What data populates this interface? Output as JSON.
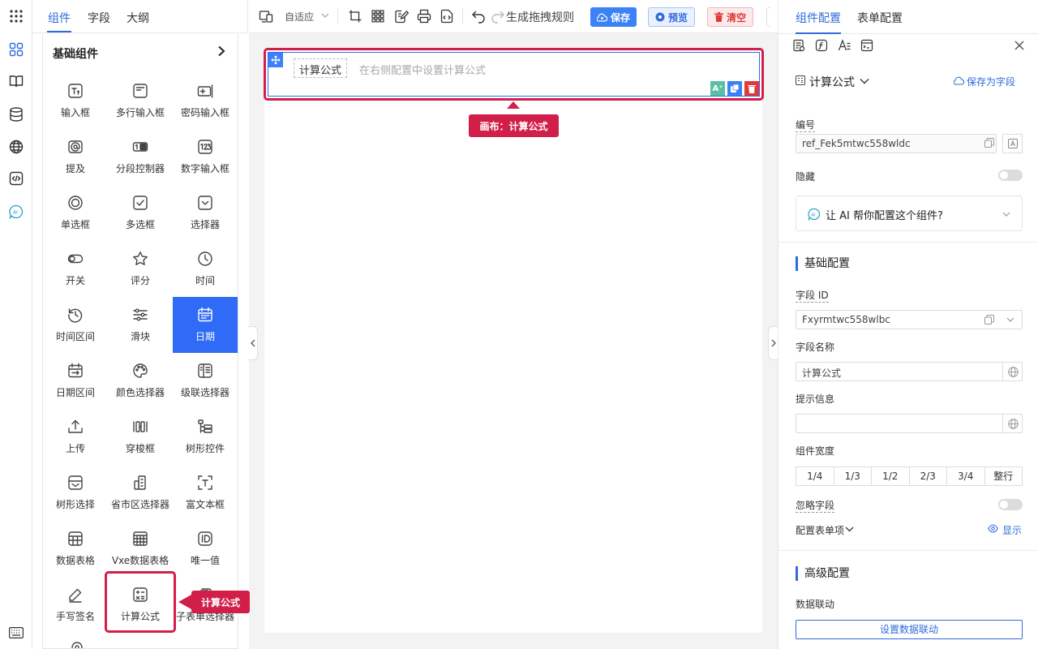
{
  "rail": {
    "items": [
      "apps-icon",
      "widgets-icon",
      "book-icon",
      "database-icon",
      "globe-icon",
      "code-icon",
      "ai-icon",
      "keyboard-icon"
    ]
  },
  "left_tabs": {
    "components": "组件",
    "fields": "字段",
    "outline": "大纲"
  },
  "panel": {
    "title": "基础组件",
    "items": [
      {
        "label": "输入框",
        "icon": "text-input-icon"
      },
      {
        "label": "多行输入框",
        "icon": "textarea-icon"
      },
      {
        "label": "密码输入框",
        "icon": "password-icon"
      },
      {
        "label": "提及",
        "icon": "mention-icon"
      },
      {
        "label": "分段控制器",
        "icon": "segmented-icon"
      },
      {
        "label": "数字输入框",
        "icon": "number-icon"
      },
      {
        "label": "单选框",
        "icon": "radio-icon"
      },
      {
        "label": "多选框",
        "icon": "checkbox-icon"
      },
      {
        "label": "选择器",
        "icon": "select-icon"
      },
      {
        "label": "开关",
        "icon": "switch-icon"
      },
      {
        "label": "评分",
        "icon": "star-icon"
      },
      {
        "label": "时间",
        "icon": "clock-icon"
      },
      {
        "label": "时间区间",
        "icon": "history-icon"
      },
      {
        "label": "滑块",
        "icon": "slider-icon"
      },
      {
        "label": "日期",
        "icon": "calendar-icon"
      },
      {
        "label": "日期区间",
        "icon": "date-range-icon"
      },
      {
        "label": "颜色选择器",
        "icon": "palette-icon"
      },
      {
        "label": "级联选择器",
        "icon": "cascader-icon"
      },
      {
        "label": "上传",
        "icon": "upload-icon"
      },
      {
        "label": "穿梭框",
        "icon": "transfer-icon"
      },
      {
        "label": "树形控件",
        "icon": "tree-icon"
      },
      {
        "label": "树形选择",
        "icon": "tree-select-icon"
      },
      {
        "label": "省市区选择器",
        "icon": "region-icon"
      },
      {
        "label": "富文本框",
        "icon": "richtext-icon"
      },
      {
        "label": "数据表格",
        "icon": "table-icon"
      },
      {
        "label": "Vxe数据表格",
        "icon": "vxe-table-icon"
      },
      {
        "label": "唯一值",
        "icon": "id-icon"
      },
      {
        "label": "手写签名",
        "icon": "pen-icon"
      },
      {
        "label": "计算公式",
        "icon": "calculator-icon"
      },
      {
        "label": "子表单选择器",
        "icon": "subform-icon"
      }
    ],
    "selected_label": "日期"
  },
  "toolbar": {
    "adaptive": "自适应",
    "generate": "生成拖拽规则",
    "save": "保存",
    "preview": "预览",
    "clear": "清空"
  },
  "canvas": {
    "field_label": "计算公式",
    "field_placeholder": "在右侧配置中设置计算公式",
    "callout": "画布：计算公式"
  },
  "panel_callout": "计算公式",
  "right": {
    "tabs": {
      "component": "组件配置",
      "form": "表单配置"
    },
    "component_name": "计算公式",
    "save_as_field": "保存为字段",
    "id_label": "编号",
    "id_value": "ref_Fek5mtwc558wldc",
    "hidden_label": "隐藏",
    "hidden_on": false,
    "ai_prompt": "让 AI 帮你配置这个组件?",
    "basic_section": "基础配置",
    "field_id_label": "字段 ID",
    "field_id_value": "Fxyrmtwc558wlbc",
    "field_name_label": "字段名称",
    "field_name_value": "计算公式",
    "hint_label": "提示信息",
    "hint_value": "",
    "width_label": "组件宽度",
    "width_options": [
      "1/4",
      "1/3",
      "1/2",
      "2/3",
      "3/4",
      "整行"
    ],
    "ignore_label": "忽略字段",
    "ignore_on": false,
    "form_item_label": "配置表单项",
    "show_label": "显示",
    "advanced_section": "高级配置",
    "linkage_label": "数据联动",
    "linkage_button": "设置数据联动"
  },
  "colors": {
    "accent": "#2f6bdc",
    "selected": "#2f6bf6",
    "danger": "#d21f4a"
  }
}
